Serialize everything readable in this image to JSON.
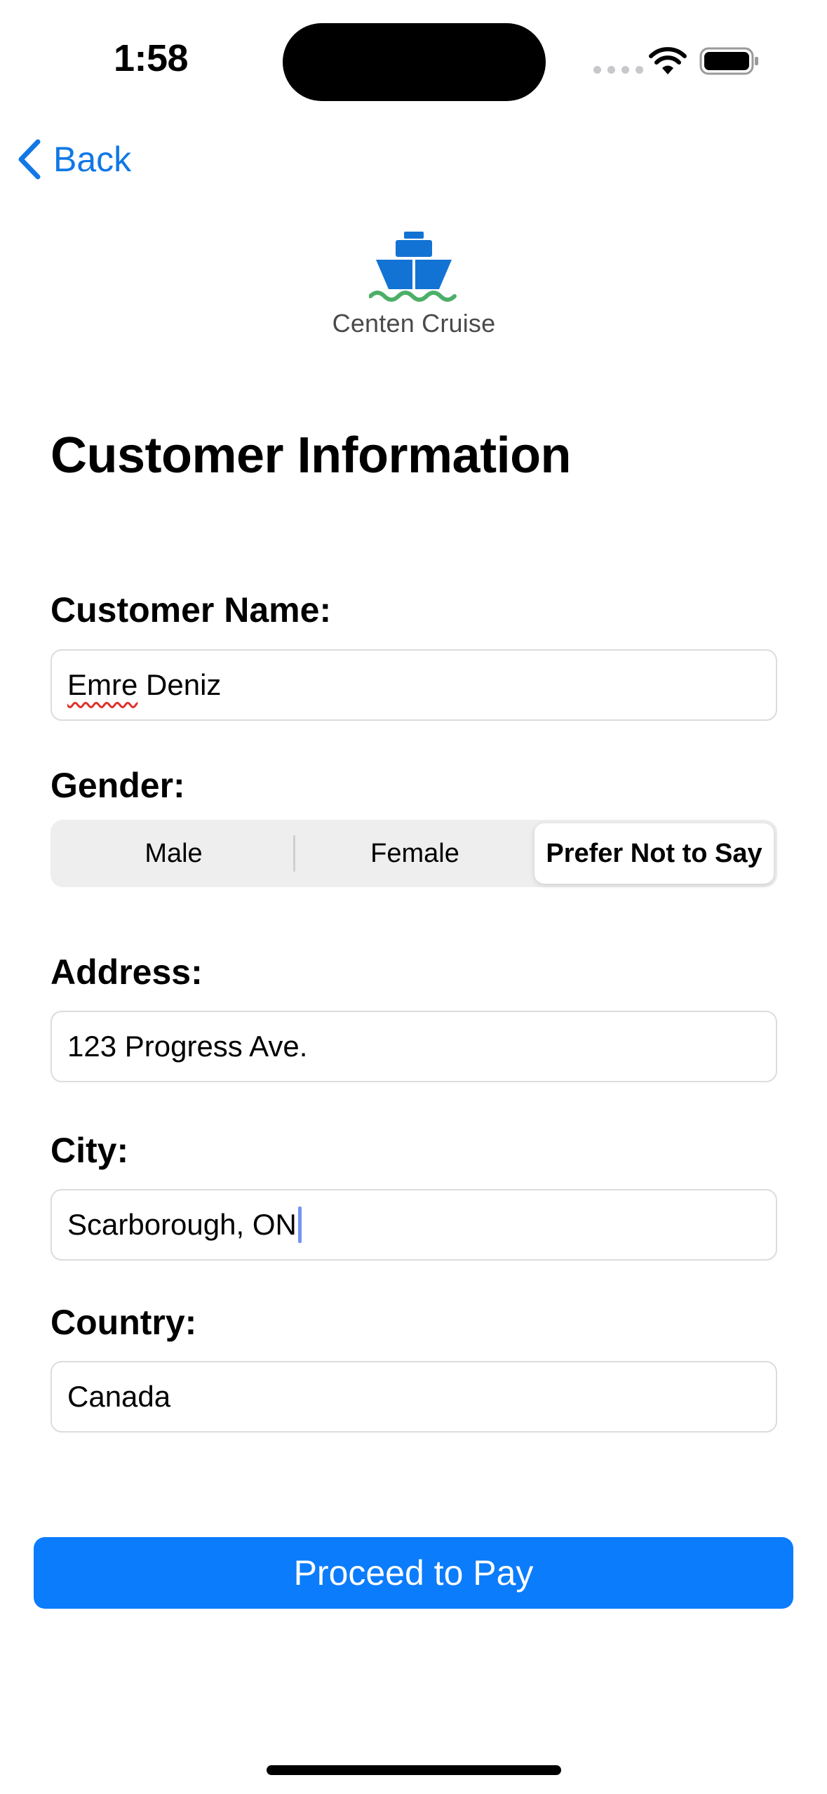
{
  "status_bar": {
    "time": "1:58"
  },
  "nav": {
    "back_label": "Back"
  },
  "logo": {
    "text": "Centen Cruise"
  },
  "page_title": "Customer Information",
  "form": {
    "customer_name": {
      "label": "Customer Name:",
      "first_word": "Emre",
      "rest": " Deniz"
    },
    "gender": {
      "label": "Gender:",
      "options": [
        "Male",
        "Female",
        "Prefer Not to Say"
      ],
      "selected": "Prefer Not to Say"
    },
    "address": {
      "label": "Address:",
      "value": "123 Progress Ave."
    },
    "city": {
      "label": "City:",
      "value": "Scarborough, ON"
    },
    "country": {
      "label": "Country:",
      "value": "Canada"
    }
  },
  "actions": {
    "proceed_label": "Proceed to Pay"
  },
  "colors": {
    "accent": "#0b7cfc",
    "link": "#1178e6",
    "logo_blue": "#1273d4",
    "logo_green": "#4caf68"
  }
}
